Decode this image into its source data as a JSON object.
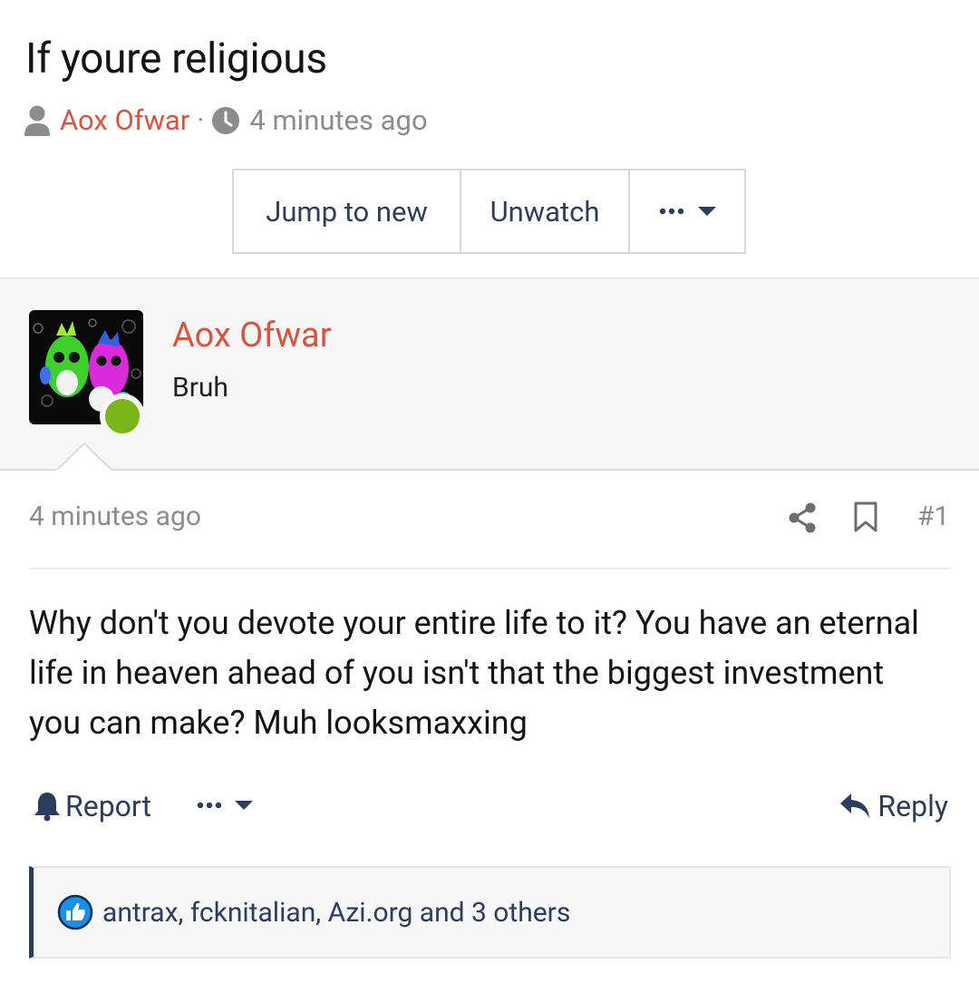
{
  "thread": {
    "title": "If youre religious",
    "author": "Aox Ofwar",
    "separator": "·",
    "time": "4 minutes ago"
  },
  "toolbar": {
    "jump_label": "Jump to new",
    "unwatch_label": "Unwatch",
    "more_icon": "ellipsis-dropdown-icon"
  },
  "post": {
    "username": "Aox Ofwar",
    "user_title": "Bruh",
    "online": true,
    "date": "4 minutes ago",
    "number": "#1",
    "body": "Why don't you devote your entire life to it? You have an eternal life in heaven ahead of you isn't that the biggest investment you can make? Muh looksmaxxing",
    "report_label": "Report",
    "reply_label": "Reply",
    "reactions_text": "antrax, fcknitalian, Azi.org and 3 others"
  },
  "colors": {
    "accent_username": "#d9533e",
    "link": "#2b3d5e",
    "online": "#7cb518",
    "like": "#1a8fe3"
  }
}
